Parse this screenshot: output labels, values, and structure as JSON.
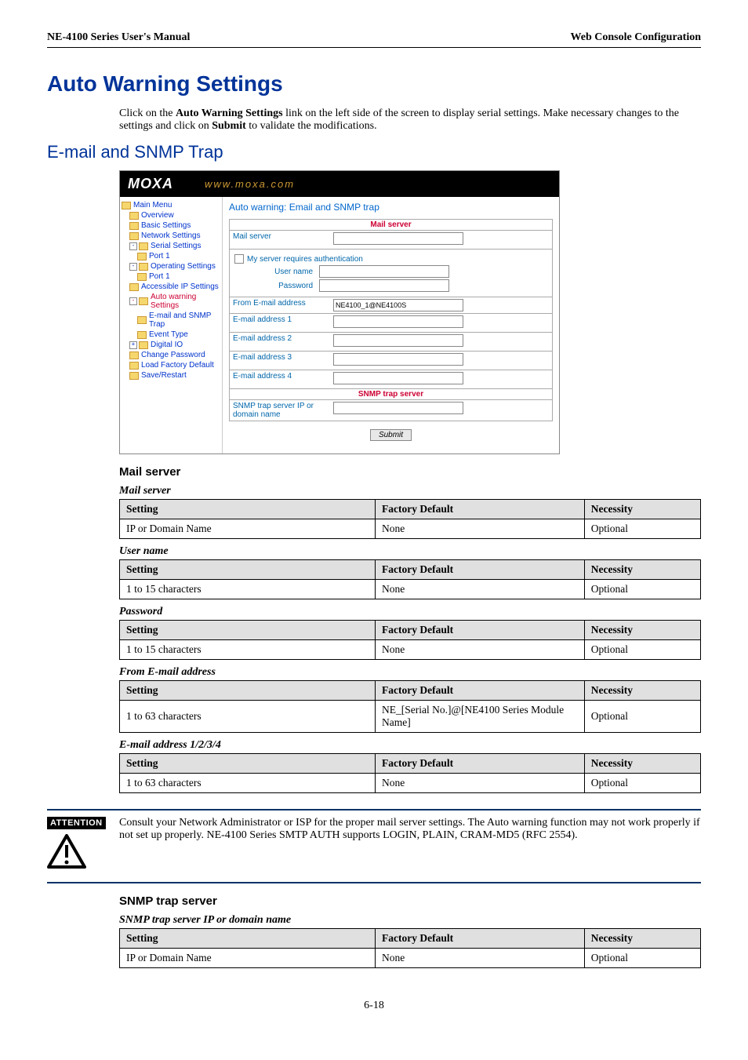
{
  "header": {
    "left": "NE-4100 Series User's Manual",
    "right": "Web Console Configuration"
  },
  "h1": "Auto Warning Settings",
  "intro_p1_1": "Click on the ",
  "intro_p1_b": "Auto Warning Settings",
  "intro_p1_2": " link on the left side of the screen to display serial settings. Make necessary changes to the settings and click on ",
  "intro_p1_b2": "Submit",
  "intro_p1_3": " to validate the modifications.",
  "h2": "E-mail and SNMP Trap",
  "screenshot": {
    "logo": "MOXA",
    "url": "www.moxa.com",
    "nav": {
      "main": "Main Menu",
      "overview": "Overview",
      "basic": "Basic Settings",
      "network": "Network Settings",
      "serial": "Serial Settings",
      "port1a": "Port 1",
      "operating": "Operating Settings",
      "port1b": "Port 1",
      "accessible": "Accessible IP Settings",
      "autowarn": "Auto warning Settings",
      "emailtrap": "E-mail and SNMP Trap",
      "eventtype": "Event Type",
      "digital": "Digital IO",
      "changepw": "Change Password",
      "loadfactory": "Load Factory Default",
      "saverestart": "Save/Restart"
    },
    "main_title": "Auto warning: Email and SNMP trap",
    "section_mail": "Mail server",
    "lbl_mailserver": "Mail server",
    "lbl_auth": "My server requires authentication",
    "lbl_user": "User name",
    "lbl_pass": "Password",
    "lbl_from": "From E-mail address",
    "val_from": "NE4100_1@NE4100S",
    "lbl_e1": "E-mail address 1",
    "lbl_e2": "E-mail address 2",
    "lbl_e3": "E-mail address 3",
    "lbl_e4": "E-mail address 4",
    "section_snmp": "SNMP trap server",
    "lbl_snmpip": "SNMP trap server IP or domain name",
    "btn_submit": "Submit"
  },
  "h3_mail": "Mail server",
  "th_setting": "Setting",
  "th_default": "Factory Default",
  "th_necess": "Necessity",
  "t_mailserver": {
    "cap": "Mail server",
    "s": "IP or Domain Name",
    "d": "None",
    "n": "Optional"
  },
  "t_username": {
    "cap": "User name",
    "s": "1 to 15 characters",
    "d": "None",
    "n": "Optional"
  },
  "t_password": {
    "cap": "Password",
    "s": "1 to 15 characters",
    "d": "None",
    "n": "Optional"
  },
  "t_fromemail": {
    "cap": "From E-mail address",
    "s": "1 to 63 characters",
    "d": "NE_[Serial No.]@[NE4100 Series Module Name]",
    "n": "Optional"
  },
  "t_emailaddr": {
    "cap": "E-mail address 1/2/3/4",
    "s": "1 to 63 characters",
    "d": "None",
    "n": "Optional"
  },
  "attention": {
    "label": "ATTENTION",
    "text": "Consult your Network Administrator or ISP for the proper mail server settings. The Auto warning function may not work properly if not set up properly. NE-4100 Series SMTP AUTH supports LOGIN, PLAIN, CRAM-MD5 (RFC 2554)."
  },
  "h3_snmp": "SNMP trap server",
  "t_snmp": {
    "cap": "SNMP trap server IP or domain name",
    "s": "IP or Domain Name",
    "d": "None",
    "n": "Optional"
  },
  "page_num": "6-18"
}
